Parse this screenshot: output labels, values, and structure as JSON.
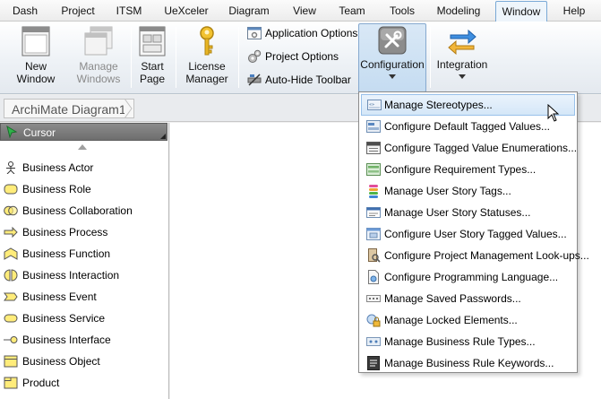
{
  "menubar": {
    "tabs": [
      {
        "label": "Dash"
      },
      {
        "label": "Project"
      },
      {
        "label": "ITSM"
      },
      {
        "label": "UeXceler"
      },
      {
        "label": "Diagram"
      },
      {
        "label": "View"
      },
      {
        "label": "Team"
      },
      {
        "label": "Tools"
      },
      {
        "label": "Modeling"
      },
      {
        "label": "Window",
        "active": true
      },
      {
        "label": "Help"
      }
    ]
  },
  "ribbon": {
    "new_window": {
      "line1": "New",
      "line2": "Window",
      "icon": "window-icon"
    },
    "manage_windows": {
      "line1": "Manage",
      "line2": "Windows",
      "icon": "windows-icon",
      "disabled": true
    },
    "start_page": {
      "line1": "Start",
      "line2": "Page",
      "icon": "start-page-icon"
    },
    "license_manager": {
      "line1": "License",
      "line2": "Manager",
      "icon": "key-icon"
    },
    "small_buttons": [
      {
        "label": "Application Options",
        "icon": "application-options-icon"
      },
      {
        "label": "Project Options",
        "icon": "project-options-icon"
      },
      {
        "label": "Auto-Hide Toolbar",
        "icon": "auto-hide-toolbar-icon"
      }
    ],
    "configuration": {
      "label": "Configuration",
      "icon": "tools-icon"
    },
    "integration": {
      "label": "Integration",
      "icon": "integration-arrows-icon"
    }
  },
  "breadcrumb": {
    "label": "ArchiMate Diagram1"
  },
  "palette": {
    "header": "Cursor",
    "items": [
      {
        "label": "Business Actor",
        "icon": "business-actor-icon"
      },
      {
        "label": "Business Role",
        "icon": "business-role-icon"
      },
      {
        "label": "Business Collaboration",
        "icon": "business-collaboration-icon"
      },
      {
        "label": "Business Process",
        "icon": "business-process-icon"
      },
      {
        "label": "Business Function",
        "icon": "business-function-icon"
      },
      {
        "label": "Business Interaction",
        "icon": "business-interaction-icon"
      },
      {
        "label": "Business Event",
        "icon": "business-event-icon"
      },
      {
        "label": "Business Service",
        "icon": "business-service-icon"
      },
      {
        "label": "Business Interface",
        "icon": "business-interface-icon"
      },
      {
        "label": "Business Object",
        "icon": "business-object-icon"
      },
      {
        "label": "Product",
        "icon": "product-icon"
      }
    ]
  },
  "configuration_menu": {
    "items": [
      {
        "label": "Manage Stereotypes...",
        "icon": "stereotype-icon"
      },
      {
        "label": "Configure Default Tagged Values...",
        "icon": "tagged-values-icon"
      },
      {
        "label": "Configure Tagged Value Enumerations...",
        "icon": "enumeration-icon"
      },
      {
        "label": "Configure Requirement Types...",
        "icon": "requirement-types-icon"
      },
      {
        "label": "Manage User Story Tags...",
        "icon": "user-story-tags-icon"
      },
      {
        "label": "Manage User Story Statuses...",
        "icon": "user-story-statuses-icon"
      },
      {
        "label": "Configure User Story Tagged Values...",
        "icon": "user-story-tagged-values-icon"
      },
      {
        "label": "Configure Project Management Look-ups...",
        "icon": "project-lookups-icon"
      },
      {
        "label": "Configure Programming Language...",
        "icon": "programming-language-icon"
      },
      {
        "label": "Manage Saved Passwords...",
        "icon": "password-icon"
      },
      {
        "label": "Manage Locked Elements...",
        "icon": "lock-icon"
      },
      {
        "label": "Manage Business Rule Types...",
        "icon": "business-rule-types-icon"
      },
      {
        "label": "Manage Business Rule Keywords...",
        "icon": "business-rule-keywords-icon"
      }
    ],
    "hover_index": 0
  },
  "colors": {
    "accent": "#7aa9d6",
    "hover": "#d5e7f8",
    "palette_header": "#7a7a7a"
  }
}
